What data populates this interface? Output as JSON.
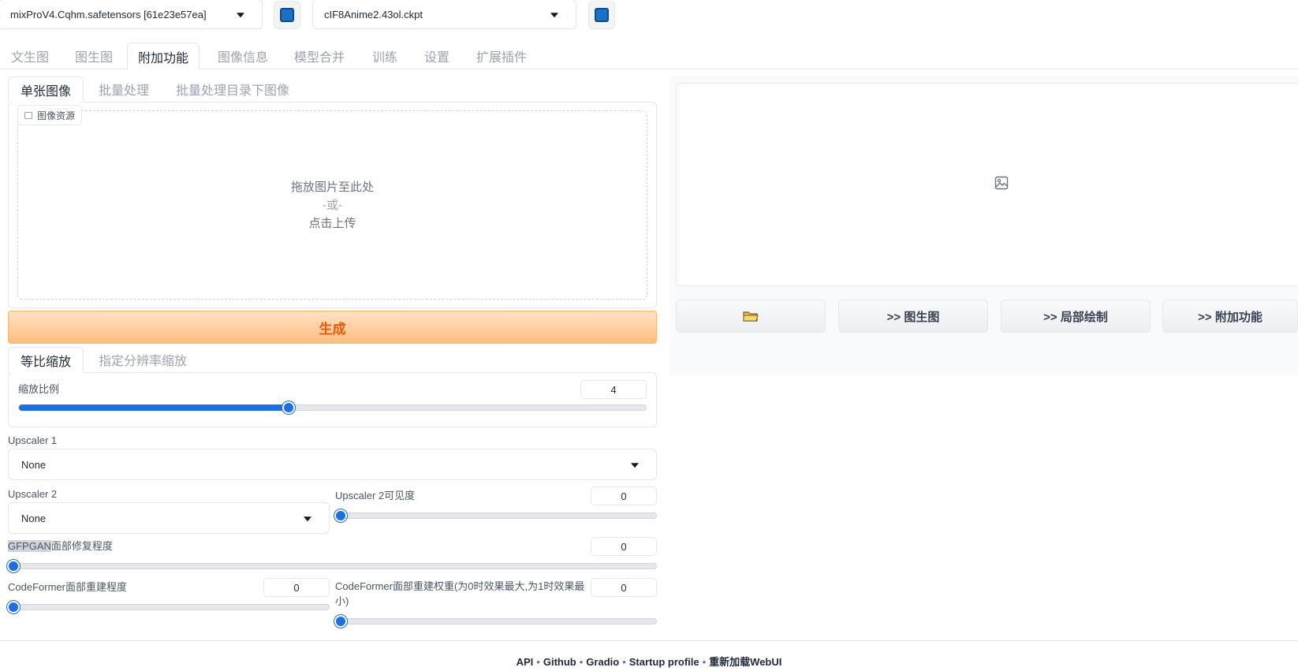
{
  "models": {
    "checkpoint": "mixProV4.Cqhm.safetensors [61e23e57ea]",
    "vae": "cIF8Anime2.43ol.ckpt"
  },
  "main_tabs": [
    "文生图",
    "图生图",
    "附加功能",
    "图像信息",
    "模型合并",
    "训练",
    "设置",
    "扩展插件"
  ],
  "active_main_tab": "附加功能",
  "sub_tabs": [
    "单张图像",
    "批量处理",
    "批量处理目录下图像"
  ],
  "image_source": {
    "label": "图像资源",
    "drop_line1": "拖放图片至此处",
    "drop_line2": "-或-",
    "drop_line3": "点击上传"
  },
  "generate_label": "生成",
  "resize_tabs": [
    "等比缩放",
    "指定分辨率缩放"
  ],
  "scale": {
    "label": "缩放比例",
    "value": "4",
    "fraction": 0.43
  },
  "upscaler1": {
    "label": "Upscaler 1",
    "value": "None"
  },
  "upscaler2": {
    "label": "Upscaler 2",
    "value": "None"
  },
  "upscaler2_visibility": {
    "label": "Upscaler 2可见度",
    "value": "0"
  },
  "gfpgan": {
    "label_prefix": "GFPGAN",
    "label_suffix": "面部修复程度",
    "value": "0"
  },
  "codeformer_visibility": {
    "label": "CodeFormer面部重建程度",
    "value": "0"
  },
  "codeformer_weight": {
    "label": "CodeFormer面部重建权重(为0时效果最大,为1时效果最小)",
    "value": "0"
  },
  "actions": {
    "folder": "📁",
    "to_img2img": ">> 图生图",
    "to_inpaint": ">> 局部绘制",
    "to_extras": ">> 附加功能"
  },
  "footer": [
    "API",
    "Github",
    "Gradio",
    "Startup profile",
    "重新加载WebUI"
  ],
  "colors": {
    "accent": "#1f6fe0",
    "generate": "#ea580c"
  }
}
